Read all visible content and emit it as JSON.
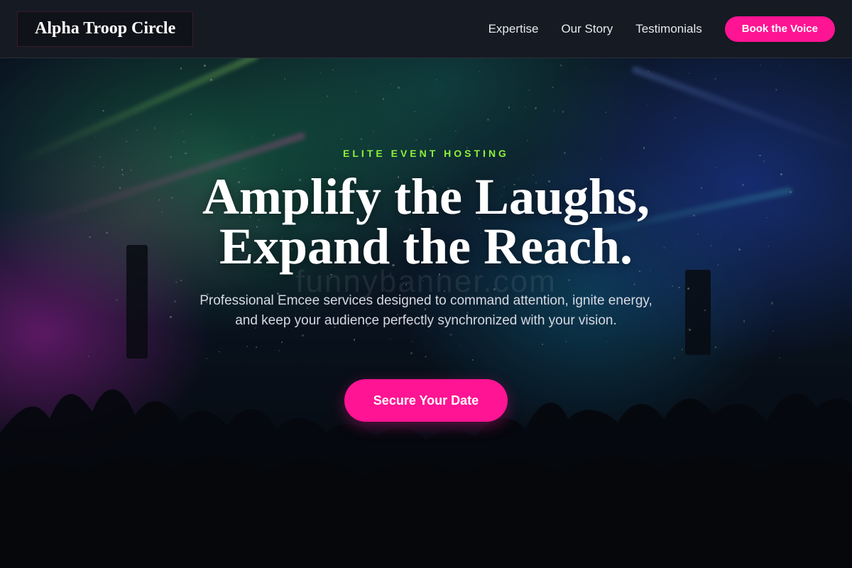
{
  "header": {
    "brand": "Alpha Troop Circle",
    "nav": [
      {
        "label": "Expertise"
      },
      {
        "label": "Our Story"
      },
      {
        "label": "Testimonials"
      }
    ],
    "cta_label": "Book the Voice"
  },
  "hero": {
    "eyebrow": "ELITE EVENT HOSTING",
    "headline_line1": "Amplify the Laughs,",
    "headline_line2": "Expand the Reach.",
    "subtext": "Professional Emcee services designed to command attention, ignite energy, and keep your audience perfectly synchronized with your vision.",
    "cta_label": "Secure Your Date",
    "watermark": "funnybanner.com"
  },
  "colors": {
    "accent": "#ff1493",
    "eyebrow": "#8ef03a",
    "header_bg": "#161a22"
  },
  "background": {
    "icon": "concert-crowd-image"
  }
}
